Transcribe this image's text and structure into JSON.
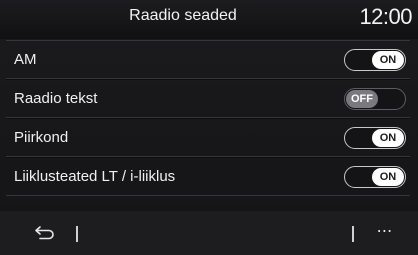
{
  "header": {
    "title": "Raadio seaded",
    "clock": "12:00"
  },
  "settings": [
    {
      "label": "AM",
      "state": "ON"
    },
    {
      "label": "Raadio tekst",
      "state": "OFF"
    },
    {
      "label": "Piirkond",
      "state": "ON"
    },
    {
      "label": "Liiklusteated LT / i-liiklus",
      "state": "ON"
    }
  ],
  "footer": {
    "back_icon": "back-arrow-icon",
    "more_label": "⋯"
  },
  "colors": {
    "background": "#1b1b1e",
    "toggle_on": "#ffffff",
    "toggle_off": "#7a7a7e"
  }
}
